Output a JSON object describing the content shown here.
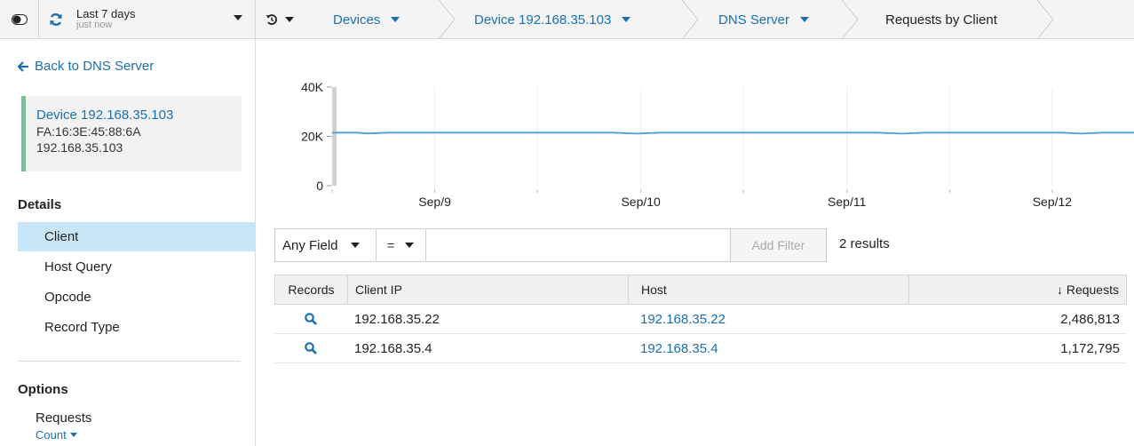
{
  "topbar": {
    "time_label": "Last 7 days",
    "time_sublabel": "just now",
    "breadcrumbs": [
      {
        "label": "Devices",
        "dropdown": true
      },
      {
        "label": "Device 192.168.35.103",
        "dropdown": true
      },
      {
        "label": "DNS Server",
        "dropdown": true
      },
      {
        "label": "Requests by Client",
        "dropdown": false
      }
    ]
  },
  "sidebar": {
    "back_label": "Back to DNS Server",
    "device": {
      "name": "Device 192.168.35.103",
      "mac": "FA:16:3E:45:88:6A",
      "ip": "192.168.35.103"
    },
    "details_heading": "Details",
    "details_items": [
      "Client",
      "Host Query",
      "Opcode",
      "Record Type"
    ],
    "active_item": "Client",
    "options_heading": "Options",
    "option_label": "Requests",
    "option_value": "Count"
  },
  "chart_data": {
    "type": "line",
    "x_tick_labels": [
      "Sep/9",
      "Sep/10",
      "Sep/11",
      "Sep/12"
    ],
    "y_tick_labels": [
      "0",
      "20K",
      "40K"
    ],
    "ylim": [
      0,
      40000
    ],
    "series": [
      {
        "values": [
          21500,
          21500,
          21200,
          21500,
          21500,
          21500,
          21500,
          21500,
          21500,
          21100,
          21500,
          21500,
          21500,
          21500,
          21500,
          21500,
          21100,
          21500,
          21500,
          21500,
          21500,
          21500,
          21100,
          21500,
          21500
        ]
      }
    ],
    "x_positions": [
      0,
      0.03,
      0.045,
      0.07,
      0.15,
      0.2,
      0.25,
      0.3,
      0.35,
      0.38,
      0.41,
      0.5,
      0.55,
      0.6,
      0.65,
      0.68,
      0.71,
      0.74,
      0.8,
      0.85,
      0.88,
      0.91,
      0.935,
      0.96,
      1
    ],
    "grid": true,
    "color": "#4a9fd8"
  },
  "filter": {
    "field": "Any Field",
    "operator": "=",
    "value": "",
    "add_label": "Add Filter",
    "results_text": "2 results"
  },
  "table": {
    "columns": [
      "Records",
      "Client IP",
      "Host",
      "↓ Requests"
    ],
    "rows": [
      {
        "client_ip": "192.168.35.22",
        "host": "192.168.35.22",
        "requests": "2,486,813"
      },
      {
        "client_ip": "192.168.35.4",
        "host": "192.168.35.4",
        "requests": "1,172,795"
      }
    ]
  },
  "colors": {
    "link": "#1a6fb0",
    "active_row": "#c9e6f7",
    "device_accent": "#7fbf95"
  }
}
